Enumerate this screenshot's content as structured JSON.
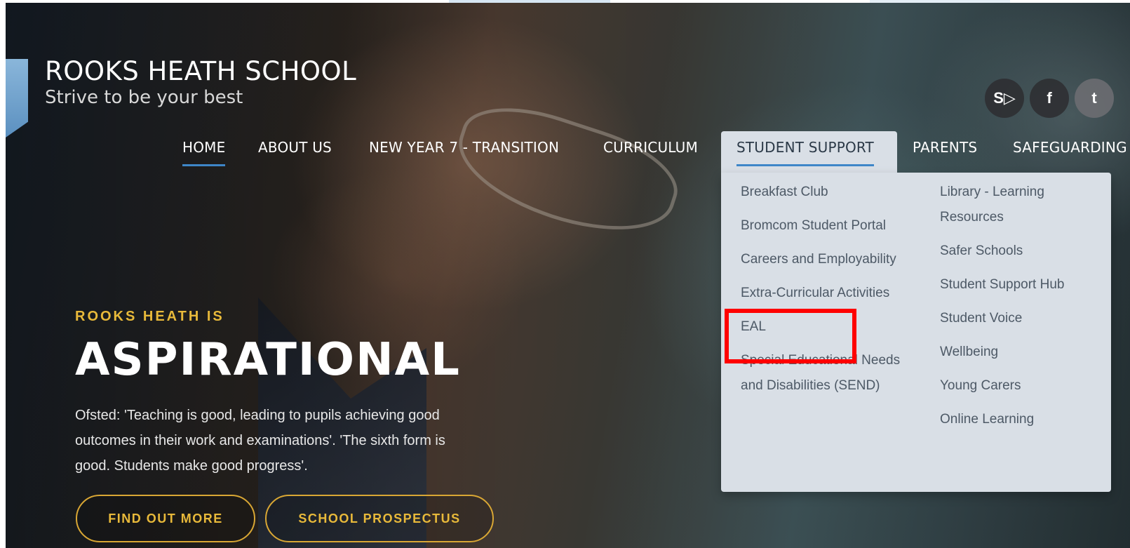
{
  "header": {
    "school_name": "ROOKS HEATH SCHOOL",
    "tagline": "Strive to be your best"
  },
  "social": {
    "sharepoint_label": "S▷",
    "facebook_label": "f",
    "twitter_label": "t"
  },
  "nav": {
    "items": [
      {
        "label": "HOME",
        "state": "active"
      },
      {
        "label": "ABOUT US"
      },
      {
        "label": "NEW YEAR 7 - TRANSITION"
      },
      {
        "label": "CURRICULUM"
      },
      {
        "label": "STUDENT SUPPORT",
        "state": "open"
      },
      {
        "label": "PARENTS"
      },
      {
        "label": "SAFEGUARDING"
      }
    ]
  },
  "dropdown": {
    "col1": [
      "Breakfast Club",
      "Bromcom Student Portal",
      "Careers and Employability",
      "Extra-Curricular Activities",
      "EAL",
      "Special Educational Needs and Disabilities (SEND)"
    ],
    "col2": [
      "Library - Learning Resources",
      "Safer Schools",
      "Student Support Hub",
      "Student Voice",
      "Wellbeing",
      "Young Carers",
      "Online Learning"
    ],
    "highlight_color": "#ff0000"
  },
  "hero": {
    "kicker": "ROOKS HEATH IS",
    "headline": "ASPIRATIONAL",
    "quote": "Ofsted: 'Teaching is good, leading to pupils achieving good outcomes in their work and examinations'. 'The sixth form is good. Students make good progress'.",
    "buttons": {
      "find_out_more": "FIND OUT MORE",
      "prospectus": "SCHOOL PROSPECTUS"
    }
  },
  "colors": {
    "accent_blue": "#3e86c8",
    "gold": "#e8b93a",
    "dropdown_bg": "#d9dfe6"
  }
}
